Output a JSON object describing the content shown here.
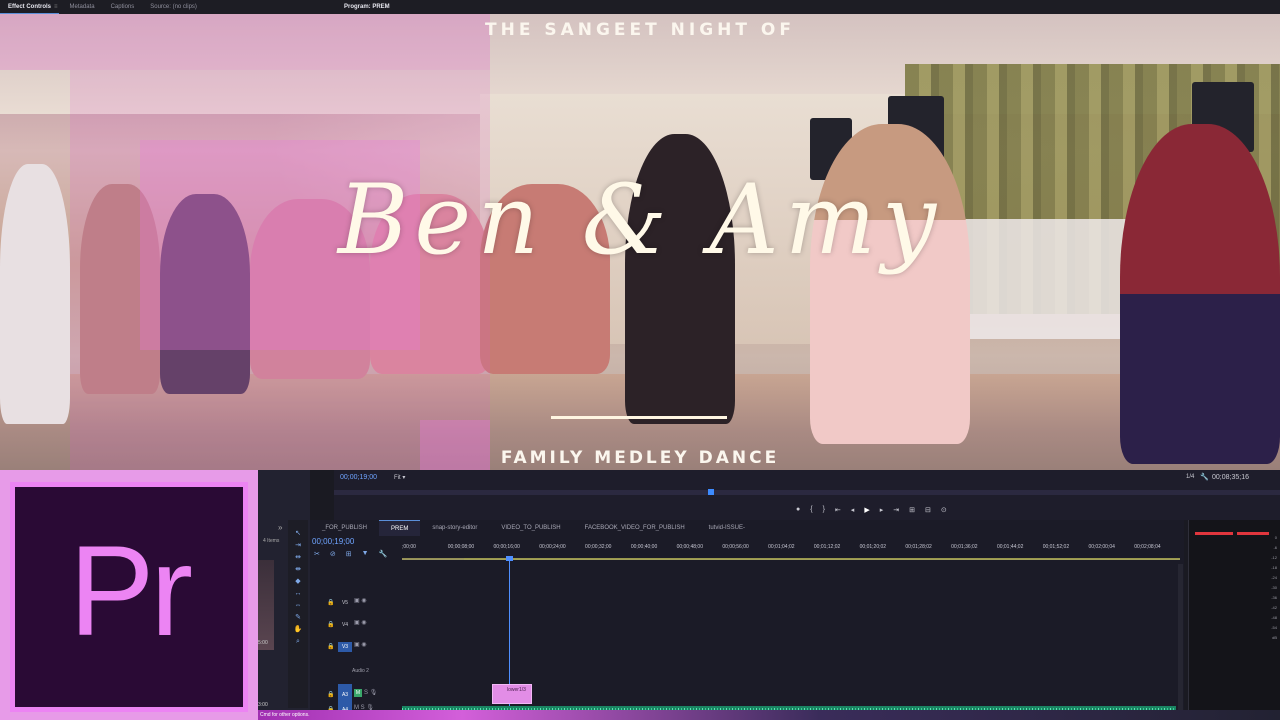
{
  "top_tabs": {
    "effect_controls": "Effect Controls",
    "metadata": "Metadata",
    "captions": "Captions",
    "source": "Source: (no clips)",
    "program": "Program: PREM"
  },
  "video": {
    "title_top": "THE SANGEET NIGHT OF",
    "title_main": "Ben & Amy",
    "title_sub": "FAMILY MEDLEY DANCE"
  },
  "logo": {
    "text": "Pr",
    "brand_color": "#ec84f3",
    "bg_color": "#2a0a35"
  },
  "program_monitor": {
    "timecode": "00;00;19;00",
    "fit": "Fit",
    "ratio": "1/4",
    "duration": "00;08;35;16",
    "transport": [
      "●",
      "{",
      "}",
      "⇤",
      "◂",
      "▶",
      "▸",
      "⇥",
      "⊞",
      "⊟",
      "⊙"
    ]
  },
  "project": {
    "items": "4 Items",
    "timecode_a": "5:00",
    "timecode_b": "3:00"
  },
  "timeline": {
    "tabs": [
      "_FOR_PUBLISH",
      "PREM",
      "snap-story-editor",
      "VIDEO_TO_PUBLISH",
      "FACEBOOK_VIDEO_FOR_PUBLISH",
      "tutvid-ISSUE-"
    ],
    "active_tab": 1,
    "timecode": "00;00;19;00",
    "ruler": [
      ";00;00",
      "00;00;08;00",
      "00;00;16;00",
      "00;00;24;00",
      "00;00;32;00",
      "00;00;40;00",
      "00;00;48;00",
      "00;00;56;00",
      "00;01;04;02",
      "00;01;12;02",
      "00;01;20;02",
      "00;01;28;02",
      "00;01;36;02",
      "00;01;44;02",
      "00;01;52;02",
      "00;02;00;04",
      "00;02;08;04"
    ],
    "tracks": {
      "v5": "V5",
      "v4": "V4",
      "v3": "V3",
      "a3": "A3",
      "a4": "A4",
      "audio_name": "Audio 2"
    },
    "graphic_clip": "lower1/3",
    "audio_fx": "fx"
  },
  "meter_scale": [
    "0",
    "-6",
    "-12",
    "-18",
    "-24",
    "-30",
    "-36",
    "-42",
    "-48",
    "-54",
    "dB"
  ],
  "meter_labels": {
    "left": "S",
    "right": "S"
  },
  "status": "Cmd for other options."
}
